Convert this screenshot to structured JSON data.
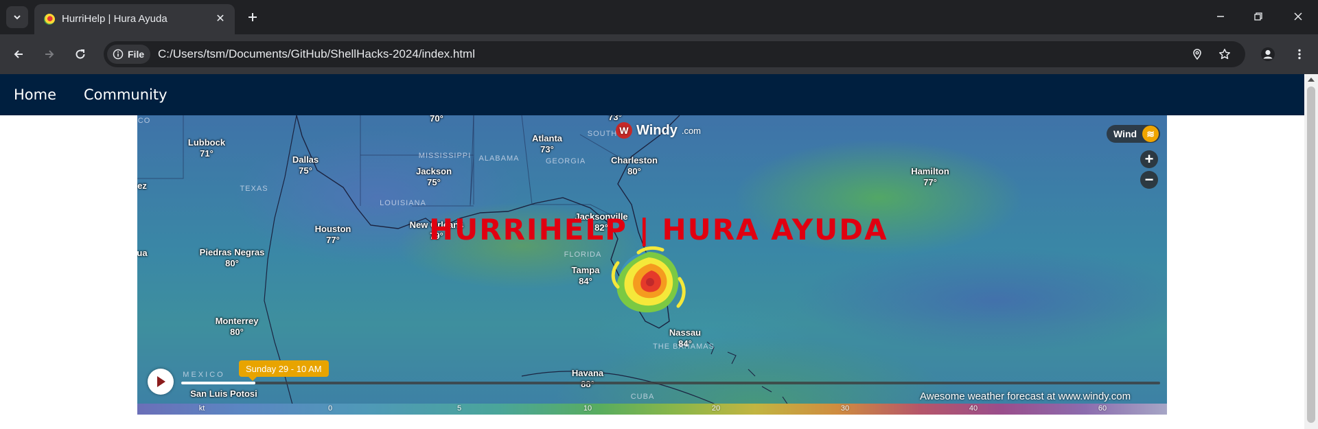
{
  "browser": {
    "tab_title": "HurriHelp | Hura Ayuda",
    "chip_label": "File",
    "url": "C:/Users/tsm/Documents/GitHub/ShellHacks-2024/index.html"
  },
  "nav": {
    "items": [
      "Home",
      "Community"
    ]
  },
  "hero": {
    "title": "HURRIHELP | HURA AYUDA"
  },
  "map": {
    "provider": "Windy",
    "provider_suffix": ".com",
    "layer": "Wind",
    "time_label": "Sunday 29 - 10 AM",
    "timeline_progress": 0.076,
    "credit": "Awesome weather forecast at www.windy.com",
    "cities": [
      {
        "name": "Lubbock",
        "temp": "71°"
      },
      {
        "name": "Dallas",
        "temp": "75°"
      },
      {
        "name": "Jackson",
        "temp": "75°"
      },
      {
        "name": "Atlanta",
        "temp": "73°"
      },
      {
        "name": "Charleston",
        "temp": "80°"
      },
      {
        "name": "Hamilton",
        "temp": "77°"
      },
      {
        "name": "Houston",
        "temp": "77°"
      },
      {
        "name": "New Orleans",
        "temp": "79°"
      },
      {
        "name": "Jacksonville",
        "temp": "82°"
      },
      {
        "name": "Piedras Negras",
        "temp": "80°"
      },
      {
        "name": "Tampa",
        "temp": "84°"
      },
      {
        "name": "Monterrey",
        "temp": "80°"
      },
      {
        "name": "Nassau",
        "temp": "84°"
      },
      {
        "name": "Havana",
        "temp": "88°"
      },
      {
        "name": "San Luis Potosi",
        "temp": ""
      }
    ],
    "regions": [
      "TEXAS",
      "MISSISSIPPI",
      "ALABAMA",
      "GEORGIA",
      "SOUTH C",
      "LOUISIANA",
      "FLORIDA",
      "THE BAHAMAS",
      "MEXICO",
      "CUBA"
    ],
    "edge_labels": [
      "CO",
      "70°",
      "73°",
      "ez",
      "ua"
    ],
    "legend": {
      "unit": "kt",
      "ticks": [
        "0",
        "5",
        "10",
        "20",
        "30",
        "40",
        "60"
      ]
    }
  }
}
